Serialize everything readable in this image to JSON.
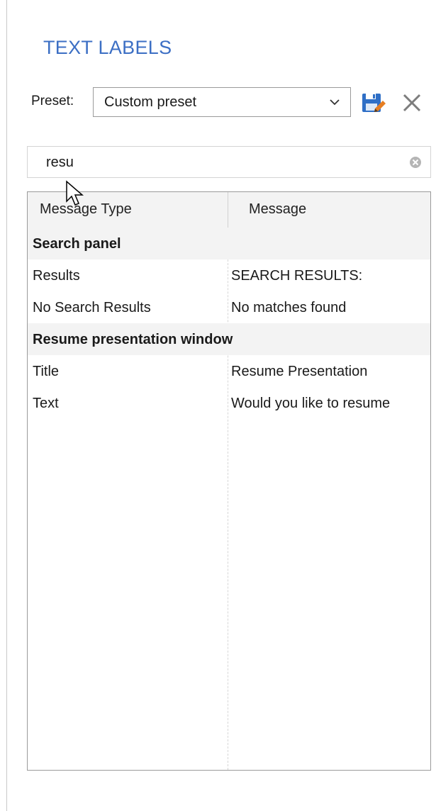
{
  "panel": {
    "title": "TEXT LABELS",
    "accent_color": "#3c6fc4"
  },
  "preset": {
    "label": "Preset:",
    "selected": "Custom preset",
    "save_icon": "save-icon",
    "delete_icon": "close-icon"
  },
  "search": {
    "value": "resu",
    "clear_icon": "clear-circle-icon"
  },
  "table": {
    "headers": [
      "Message Type",
      "Message"
    ],
    "rows": [
      {
        "kind": "group",
        "type": "Search panel",
        "message": ""
      },
      {
        "kind": "item",
        "type": "Results",
        "message": "SEARCH RESULTS:"
      },
      {
        "kind": "item",
        "type": "No Search Results",
        "message": "No matches found"
      },
      {
        "kind": "group",
        "type": "Resume presentation window",
        "message": ""
      },
      {
        "kind": "item",
        "type": "Title",
        "message": "Resume Presentation"
      },
      {
        "kind": "item",
        "type": "Text",
        "message": "Would you like to resume"
      }
    ]
  }
}
